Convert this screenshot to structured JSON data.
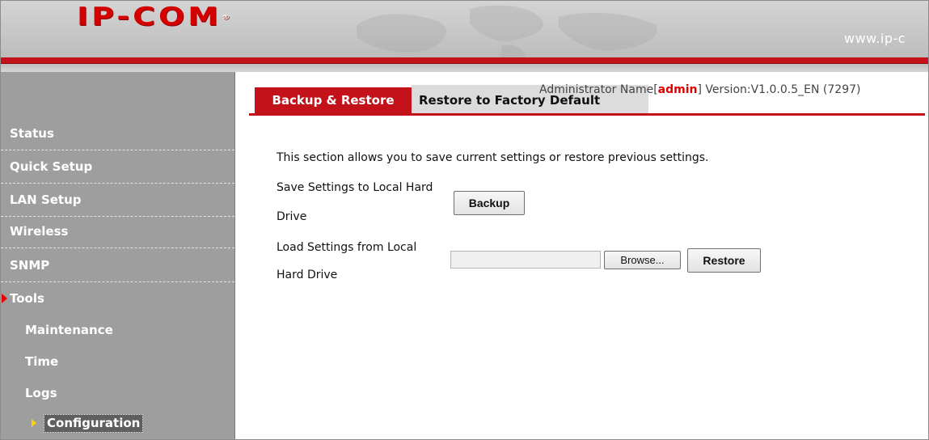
{
  "header": {
    "logo_text": "IP-COM",
    "logo_mark": "®",
    "site_url": "www.ip-c",
    "brand_color": "#c4121b"
  },
  "sidebar": {
    "items": [
      {
        "label": "Status"
      },
      {
        "label": "Quick Setup"
      },
      {
        "label": "LAN Setup"
      },
      {
        "label": "Wireless"
      },
      {
        "label": "SNMP"
      },
      {
        "label": "Tools",
        "icon": "red-arrow-icon",
        "expanded": true
      },
      {
        "label": "Maintenance"
      },
      {
        "label": "Time"
      },
      {
        "label": "Logs"
      },
      {
        "label": "Configuration",
        "icon": "yellow-arrow-icon",
        "selected": true
      }
    ]
  },
  "tabs": [
    {
      "label": "Backup & Restore",
      "active": true
    },
    {
      "label": "Restore to Factory Default",
      "active": false
    }
  ],
  "status": {
    "admin_prefix": "Administrator Name[",
    "admin_name": "admin",
    "admin_suffix": "] Version:V1.0.0.5_EN (7297)"
  },
  "content": {
    "description": "This section allows you to save current settings or restore previous settings.",
    "backup": {
      "label_line1": "Save Settings to Local Hard",
      "label_line2": "Drive",
      "button": "Backup"
    },
    "restore": {
      "label_line1": "Load Settings from Local",
      "label_line2": "Hard Drive",
      "file_value": "",
      "browse_button": "Browse...",
      "button": "Restore"
    }
  }
}
